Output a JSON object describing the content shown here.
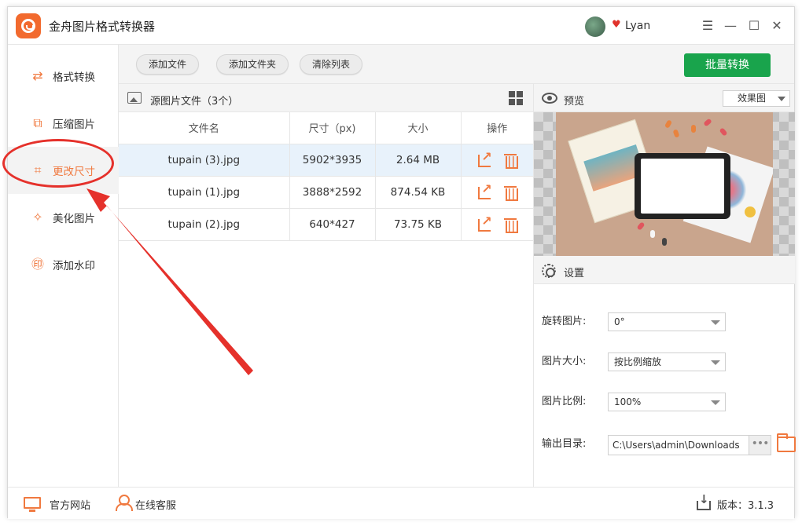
{
  "app": {
    "title": "金舟图片格式转换器",
    "user_name": "Lyan",
    "window_controls": [
      "menu-icon",
      "minimize-icon",
      "maximize-icon",
      "close-icon"
    ]
  },
  "sidebar": {
    "items": [
      {
        "label": "格式转换",
        "icon": "convert-icon"
      },
      {
        "label": "压缩图片",
        "icon": "compress-icon"
      },
      {
        "label": "更改尺寸",
        "icon": "resize-icon",
        "active": true
      },
      {
        "label": "美化图片",
        "icon": "beautify-icon"
      },
      {
        "label": "添加水印",
        "icon": "watermark-icon"
      }
    ]
  },
  "toolbar": {
    "add_file": "添加文件",
    "add_folder": "添加文件夹",
    "clear_list": "清除列表",
    "batch_convert": "批量转换"
  },
  "file_list": {
    "title": "源图片文件（3个）",
    "columns": [
      "文件名",
      "尺寸（px)",
      "大小",
      "操作"
    ],
    "rows": [
      {
        "name": "tupain (3).jpg",
        "size_px": "5902*3935",
        "size": "2.64 MB",
        "selected": true
      },
      {
        "name": "tupain (1).jpg",
        "size_px": "3888*2592",
        "size": "874.54 KB"
      },
      {
        "name": "tupain (2).jpg",
        "size_px": "640*427",
        "size": "73.75 KB"
      }
    ]
  },
  "preview": {
    "title": "预览",
    "mode": "效果图"
  },
  "settings": {
    "title": "设置",
    "rotate_label": "旋转图片:",
    "rotate_value": "0°",
    "size_label": "图片大小:",
    "size_value": "按比例缩放",
    "ratio_label": "图片比例:",
    "ratio_value": "100%",
    "output_label": "输出目录:",
    "output_value": "C:\\Users\\admin\\Downloads",
    "more": "•••"
  },
  "footer": {
    "website": "官方网站",
    "service": "在线客服",
    "version": "版本：3.1.3"
  },
  "colors": {
    "accent": "#f0793f",
    "batch_button": "#19a44c",
    "annotation": "#e5312b",
    "selected_row": "#e8f2fb"
  }
}
